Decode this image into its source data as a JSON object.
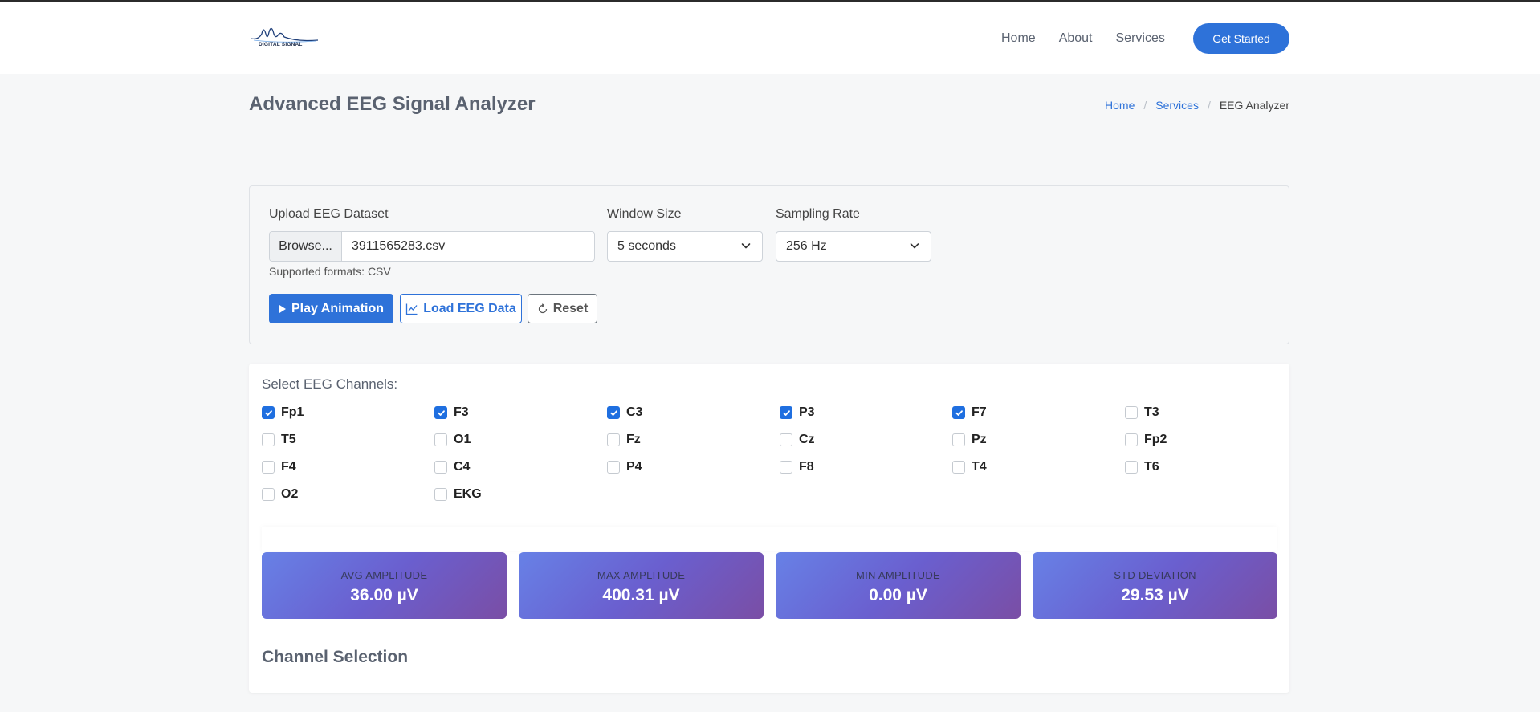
{
  "header": {
    "logo_text": "DIGITAL SIGNAL",
    "nav": [
      "Home",
      "About",
      "Services"
    ],
    "cta_label": "Get Started"
  },
  "page": {
    "title": "Advanced EEG Signal Analyzer",
    "breadcrumb": [
      "Home",
      "Services",
      "EEG Analyzer"
    ]
  },
  "upload": {
    "dataset_label": "Upload EEG Dataset",
    "browse_label": "Browse...",
    "file_name": "3911565283.csv",
    "hint": "Supported formats: CSV",
    "window_label": "Window Size",
    "window_value": "5 seconds",
    "rate_label": "Sampling Rate",
    "rate_value": "256 Hz",
    "play_label": "Play Animation",
    "load_label": "Load EEG Data",
    "reset_label": "Reset"
  },
  "channels": {
    "heading": "Select EEG Channels:",
    "items": [
      {
        "name": "Fp1",
        "checked": true
      },
      {
        "name": "F3",
        "checked": true
      },
      {
        "name": "C3",
        "checked": true
      },
      {
        "name": "P3",
        "checked": true
      },
      {
        "name": "F7",
        "checked": true
      },
      {
        "name": "T3",
        "checked": false
      },
      {
        "name": "T5",
        "checked": false
      },
      {
        "name": "O1",
        "checked": false
      },
      {
        "name": "Fz",
        "checked": false
      },
      {
        "name": "Cz",
        "checked": false
      },
      {
        "name": "Pz",
        "checked": false
      },
      {
        "name": "Fp2",
        "checked": false
      },
      {
        "name": "F4",
        "checked": false
      },
      {
        "name": "C4",
        "checked": false
      },
      {
        "name": "P4",
        "checked": false
      },
      {
        "name": "F8",
        "checked": false
      },
      {
        "name": "T4",
        "checked": false
      },
      {
        "name": "T6",
        "checked": false
      },
      {
        "name": "O2",
        "checked": false
      },
      {
        "name": "EKG",
        "checked": false
      }
    ]
  },
  "stats": [
    {
      "label": "AVG AMPLITUDE",
      "value": "36.00 µV"
    },
    {
      "label": "MAX AMPLITUDE",
      "value": "400.31 µV"
    },
    {
      "label": "MIN AMPLITUDE",
      "value": "0.00 µV"
    },
    {
      "label": "STD DEVIATION",
      "value": "29.53 µV"
    }
  ],
  "section_title": "Channel Selection",
  "colors": {
    "primary": "#2e72d9",
    "checkbox": "#1f6fe0",
    "stat_gradient_start": "#6781e6",
    "stat_gradient_end": "#7a4ea5"
  }
}
